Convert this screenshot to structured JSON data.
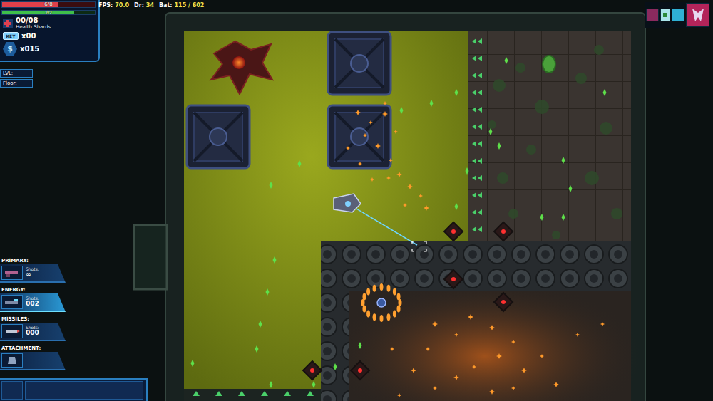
{
  "hud": {
    "health": {
      "reading": "6/8",
      "level": 0.6
    },
    "energy": {
      "reading": "2/2",
      "level": 0.78
    },
    "health_shards": {
      "count": "00/08",
      "label": "Health Shards"
    },
    "keys": {
      "icon": "KEY",
      "count": "x00"
    },
    "money": {
      "icon": "$",
      "count": "x015"
    },
    "info": [
      {
        "label": "LVL:"
      },
      {
        "label": "Floor:"
      }
    ]
  },
  "stats": [
    {
      "label": "FPS:",
      "value": "70.0"
    },
    {
      "label": "Dr:",
      "value": "34"
    },
    {
      "label": "Bat:",
      "value": "115 / 602"
    }
  ],
  "weapons": [
    {
      "label": "PRIMARY:",
      "shots_label": "Shots:",
      "shots": "∞",
      "selected": false,
      "kind": "primary"
    },
    {
      "label": "ENERGY:",
      "shots_label": "Shots:",
      "shots": "002",
      "selected": true,
      "kind": "energy"
    },
    {
      "label": "MISSILES:",
      "shots_label": "Shots:",
      "shots": "000",
      "selected": false,
      "kind": "missile"
    },
    {
      "label": "ATTACHMENT:",
      "selected": false,
      "kind": "attachment"
    }
  ],
  "minimap": {
    "rooms": [
      {
        "kind": "room",
        "color": "#8a2a5e"
      },
      {
        "kind": "current",
        "color": "#a9e4ea"
      },
      {
        "kind": "room",
        "color": "#2fb0d5"
      },
      {
        "kind": "boss",
        "color": "#b3245a"
      }
    ]
  }
}
